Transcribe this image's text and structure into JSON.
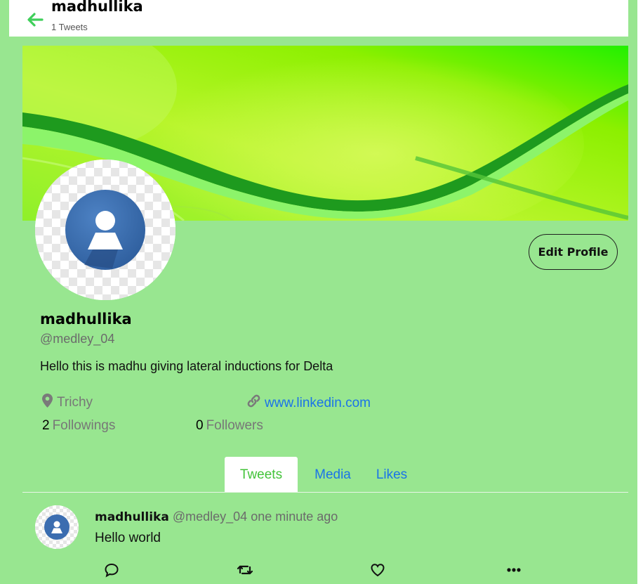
{
  "header": {
    "name": "madhullika",
    "tweet_count": "1 Tweets"
  },
  "profile": {
    "edit_button": "Edit Profile",
    "name": "madhullika",
    "handle": "@medley_04",
    "bio": "Hello this is madhu giving lateral inductions for Delta",
    "location": "Trichy",
    "website": "www.linkedin.com",
    "followings_count": "2",
    "followings_label": "Followings",
    "followers_count": "0",
    "followers_label": "Followers"
  },
  "tabs": [
    {
      "label": "Tweets",
      "active": true
    },
    {
      "label": "Media",
      "active": false
    },
    {
      "label": "Likes",
      "active": false
    }
  ],
  "tweets": [
    {
      "name": "madhullika",
      "handle": "@medley_04",
      "time": "one minute ago",
      "text": "Hello world",
      "actions": [
        "reply-icon",
        "retweet-icon",
        "like-icon",
        "more-icon"
      ]
    }
  ],
  "colors": {
    "page_background": "#98e690",
    "accent_green": "#43c33a",
    "link_blue": "#1a73e8",
    "avatar_blue": "#3b6db0"
  }
}
